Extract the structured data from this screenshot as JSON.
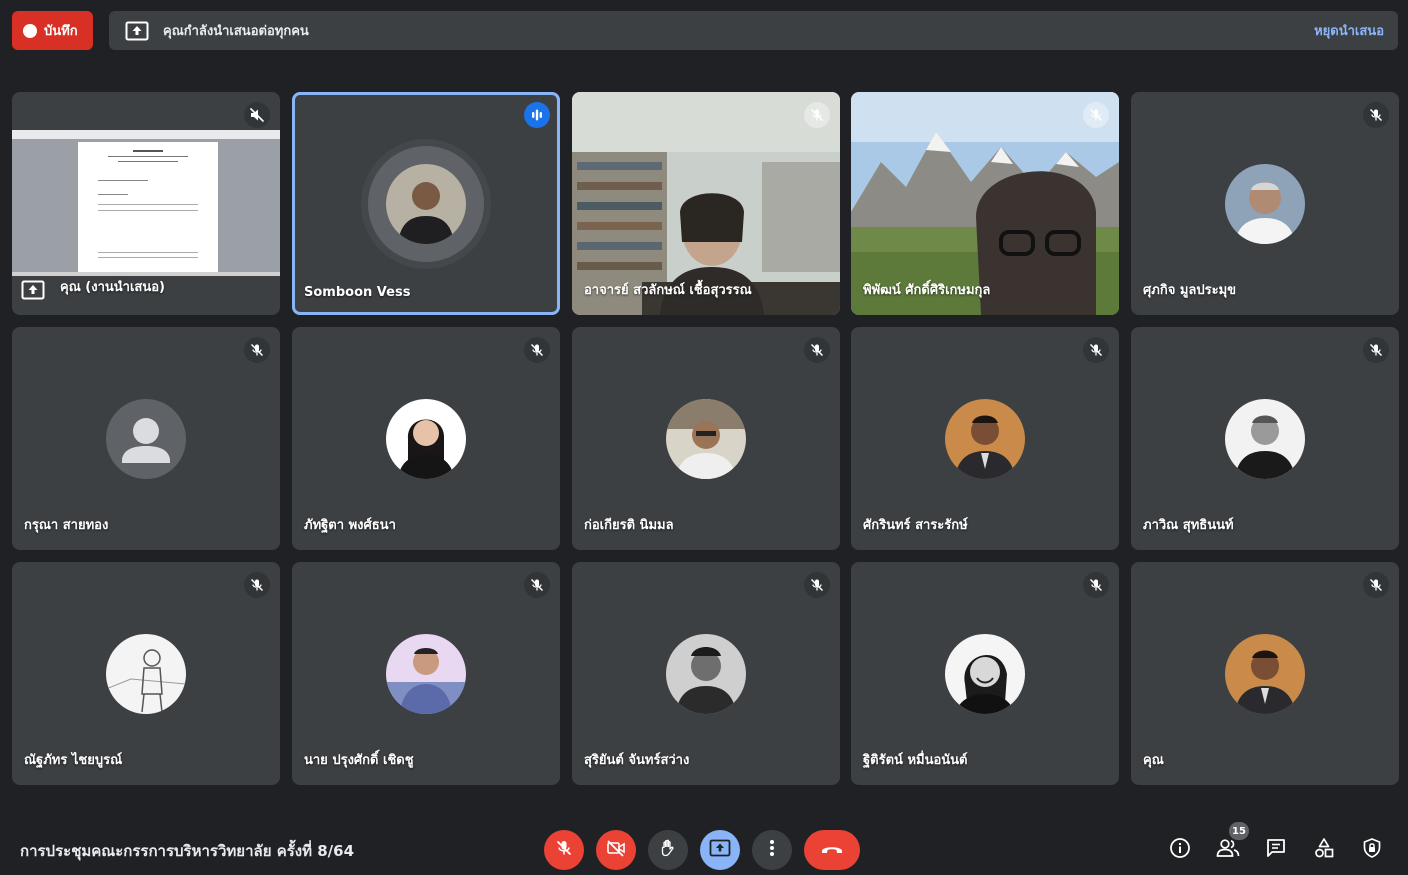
{
  "top_bar": {
    "record_label": "บันทึก",
    "presenting_text": "คุณกำลังนำเสนอต่อทุกคน",
    "stop_presenting_label": "หยุดนำเสนอ"
  },
  "participants": [
    {
      "name": "คุณ (งานนำเสนอ)",
      "type": "presentation",
      "mic": "speaker-off"
    },
    {
      "name": "Somboon Vess",
      "type": "avatar-ring",
      "mic": "speaking"
    },
    {
      "name": "อาจารย์ สวลักษณ์ เชื้อสุวรรณ",
      "type": "video-room",
      "mic": "muted"
    },
    {
      "name": "พิพัฒน์ ศักดิ์ศิริเกษมกุล",
      "type": "video-mountain",
      "mic": "muted"
    },
    {
      "name": "ศุภกิจ มูลประมุข",
      "type": "avatar",
      "mic": "muted"
    },
    {
      "name": "กรุณา สายทอง",
      "type": "avatar-default",
      "mic": "muted"
    },
    {
      "name": "ภัทฐิตา พงศ์ธนา",
      "type": "avatar",
      "mic": "muted"
    },
    {
      "name": "ก่อเกียรติ นิมมล",
      "type": "avatar",
      "mic": "muted"
    },
    {
      "name": "ศักรินทร์ สาระรักษ์",
      "type": "avatar",
      "mic": "muted"
    },
    {
      "name": "ภาวิณ สุทธินนท์",
      "type": "avatar",
      "mic": "muted"
    },
    {
      "name": "ณัฐภัทร ไชยบูรณ์",
      "type": "avatar",
      "mic": "muted"
    },
    {
      "name": "นาย ปรุงศักดิ์ เชิดชู",
      "type": "avatar",
      "mic": "muted"
    },
    {
      "name": "สุริยันต์ จันทร์สว่าง",
      "type": "avatar",
      "mic": "muted"
    },
    {
      "name": "ฐิติรัตน์ หมื่นอนันต์",
      "type": "avatar",
      "mic": "muted"
    },
    {
      "name": "คุณ",
      "type": "avatar",
      "mic": "muted"
    }
  ],
  "bottom_bar": {
    "meeting_title": "การประชุมคณะกรรการบริหารวิทยาลัย ครั้งที่ 8/64",
    "participant_count": "15"
  },
  "colors": {
    "background": "#202124",
    "tile": "#3c4043",
    "record_red": "#d93025",
    "end_call_red": "#ea4335",
    "accent_blue": "#8ab4f8",
    "speaking_blue": "#1a73e8"
  }
}
